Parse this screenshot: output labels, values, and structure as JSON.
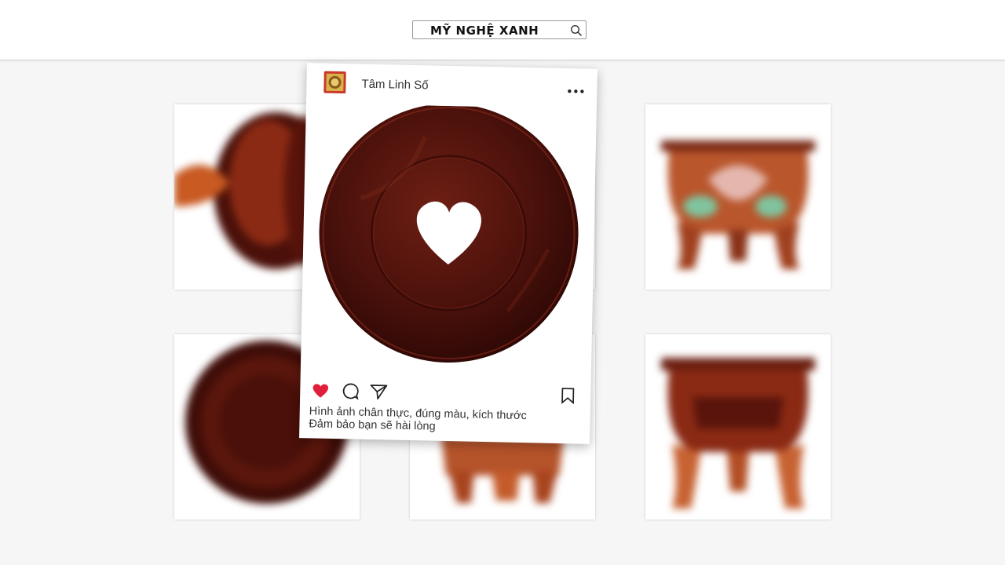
{
  "header": {
    "search_text": "MỸ NGHỆ XANH",
    "search_icon": "search-icon"
  },
  "post": {
    "username": "Tâm Linh Số",
    "avatar": "brand-logo",
    "caption_line1": "Hình ảnh chân thực, đúng màu, kích thước",
    "caption_line2": "Đảm bảo bạn sẽ hài lòng",
    "actions": [
      "like-icon",
      "comment-icon",
      "share-icon",
      "bookmark-icon"
    ],
    "liked": true,
    "like_color": "#e0203a"
  },
  "gallery": {
    "tiles": [
      "wooden-stand-side",
      "round-wooden-stand-top",
      "lotus-footed-pot",
      "round-wooden-stand-base",
      "three-legged-stand",
      "three-legged-pot"
    ]
  },
  "colors": {
    "wood_dark": "#3d0d0a",
    "wood_mid": "#6b1e12",
    "wood_light": "#c0562a",
    "background": "#f6f6f6"
  }
}
